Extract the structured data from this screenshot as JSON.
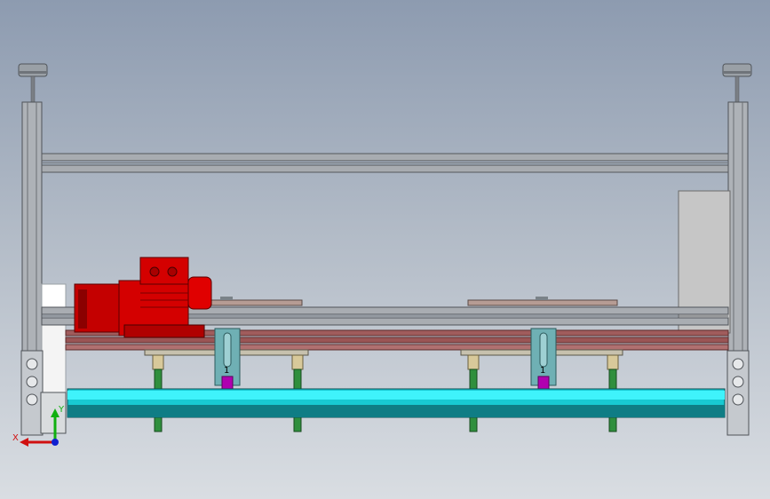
{
  "view": {
    "name": "cad-viewport",
    "background_top": "#8d9bb0",
    "background_bottom": "#d9dde2"
  },
  "colors": {
    "frame": "#a9adb3",
    "frame_dark": "#5d6166",
    "motor": "#d40000",
    "motor_dark": "#8b0000",
    "roller": "#1fe3ec",
    "roller_dark": "#0a6e73",
    "rail": "#9c5a5a",
    "rod": "#2e8b3a",
    "bracket": "#6fb0b4",
    "bolt": "#b000b0",
    "panel": "#c8c8c8"
  },
  "callouts": {
    "left": "1",
    "right": "1"
  },
  "triad": {
    "x_label": "X",
    "y_label": "Y",
    "x_color": "#d01010",
    "y_color": "#10b010",
    "z_color": "#1020d0"
  }
}
